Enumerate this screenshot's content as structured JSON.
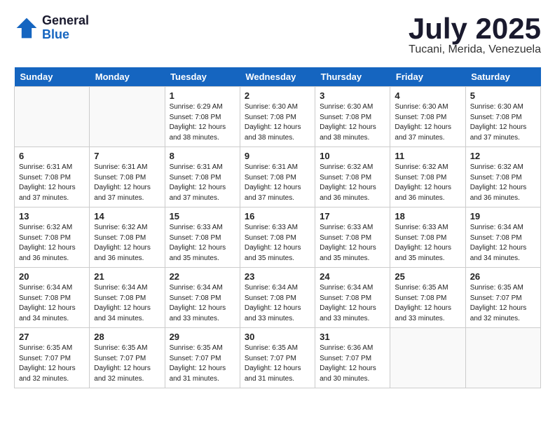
{
  "logo": {
    "general": "General",
    "blue": "Blue"
  },
  "header": {
    "month": "July 2025",
    "location": "Tucani, Merida, Venezuela"
  },
  "weekdays": [
    "Sunday",
    "Monday",
    "Tuesday",
    "Wednesday",
    "Thursday",
    "Friday",
    "Saturday"
  ],
  "weeks": [
    [
      {
        "day": "",
        "info": ""
      },
      {
        "day": "",
        "info": ""
      },
      {
        "day": "1",
        "info": "Sunrise: 6:29 AM\nSunset: 7:08 PM\nDaylight: 12 hours and 38 minutes."
      },
      {
        "day": "2",
        "info": "Sunrise: 6:30 AM\nSunset: 7:08 PM\nDaylight: 12 hours and 38 minutes."
      },
      {
        "day": "3",
        "info": "Sunrise: 6:30 AM\nSunset: 7:08 PM\nDaylight: 12 hours and 38 minutes."
      },
      {
        "day": "4",
        "info": "Sunrise: 6:30 AM\nSunset: 7:08 PM\nDaylight: 12 hours and 37 minutes."
      },
      {
        "day": "5",
        "info": "Sunrise: 6:30 AM\nSunset: 7:08 PM\nDaylight: 12 hours and 37 minutes."
      }
    ],
    [
      {
        "day": "6",
        "info": "Sunrise: 6:31 AM\nSunset: 7:08 PM\nDaylight: 12 hours and 37 minutes."
      },
      {
        "day": "7",
        "info": "Sunrise: 6:31 AM\nSunset: 7:08 PM\nDaylight: 12 hours and 37 minutes."
      },
      {
        "day": "8",
        "info": "Sunrise: 6:31 AM\nSunset: 7:08 PM\nDaylight: 12 hours and 37 minutes."
      },
      {
        "day": "9",
        "info": "Sunrise: 6:31 AM\nSunset: 7:08 PM\nDaylight: 12 hours and 37 minutes."
      },
      {
        "day": "10",
        "info": "Sunrise: 6:32 AM\nSunset: 7:08 PM\nDaylight: 12 hours and 36 minutes."
      },
      {
        "day": "11",
        "info": "Sunrise: 6:32 AM\nSunset: 7:08 PM\nDaylight: 12 hours and 36 minutes."
      },
      {
        "day": "12",
        "info": "Sunrise: 6:32 AM\nSunset: 7:08 PM\nDaylight: 12 hours and 36 minutes."
      }
    ],
    [
      {
        "day": "13",
        "info": "Sunrise: 6:32 AM\nSunset: 7:08 PM\nDaylight: 12 hours and 36 minutes."
      },
      {
        "day": "14",
        "info": "Sunrise: 6:32 AM\nSunset: 7:08 PM\nDaylight: 12 hours and 36 minutes."
      },
      {
        "day": "15",
        "info": "Sunrise: 6:33 AM\nSunset: 7:08 PM\nDaylight: 12 hours and 35 minutes."
      },
      {
        "day": "16",
        "info": "Sunrise: 6:33 AM\nSunset: 7:08 PM\nDaylight: 12 hours and 35 minutes."
      },
      {
        "day": "17",
        "info": "Sunrise: 6:33 AM\nSunset: 7:08 PM\nDaylight: 12 hours and 35 minutes."
      },
      {
        "day": "18",
        "info": "Sunrise: 6:33 AM\nSunset: 7:08 PM\nDaylight: 12 hours and 35 minutes."
      },
      {
        "day": "19",
        "info": "Sunrise: 6:34 AM\nSunset: 7:08 PM\nDaylight: 12 hours and 34 minutes."
      }
    ],
    [
      {
        "day": "20",
        "info": "Sunrise: 6:34 AM\nSunset: 7:08 PM\nDaylight: 12 hours and 34 minutes."
      },
      {
        "day": "21",
        "info": "Sunrise: 6:34 AM\nSunset: 7:08 PM\nDaylight: 12 hours and 34 minutes."
      },
      {
        "day": "22",
        "info": "Sunrise: 6:34 AM\nSunset: 7:08 PM\nDaylight: 12 hours and 33 minutes."
      },
      {
        "day": "23",
        "info": "Sunrise: 6:34 AM\nSunset: 7:08 PM\nDaylight: 12 hours and 33 minutes."
      },
      {
        "day": "24",
        "info": "Sunrise: 6:34 AM\nSunset: 7:08 PM\nDaylight: 12 hours and 33 minutes."
      },
      {
        "day": "25",
        "info": "Sunrise: 6:35 AM\nSunset: 7:08 PM\nDaylight: 12 hours and 33 minutes."
      },
      {
        "day": "26",
        "info": "Sunrise: 6:35 AM\nSunset: 7:07 PM\nDaylight: 12 hours and 32 minutes."
      }
    ],
    [
      {
        "day": "27",
        "info": "Sunrise: 6:35 AM\nSunset: 7:07 PM\nDaylight: 12 hours and 32 minutes."
      },
      {
        "day": "28",
        "info": "Sunrise: 6:35 AM\nSunset: 7:07 PM\nDaylight: 12 hours and 32 minutes."
      },
      {
        "day": "29",
        "info": "Sunrise: 6:35 AM\nSunset: 7:07 PM\nDaylight: 12 hours and 31 minutes."
      },
      {
        "day": "30",
        "info": "Sunrise: 6:35 AM\nSunset: 7:07 PM\nDaylight: 12 hours and 31 minutes."
      },
      {
        "day": "31",
        "info": "Sunrise: 6:36 AM\nSunset: 7:07 PM\nDaylight: 12 hours and 30 minutes."
      },
      {
        "day": "",
        "info": ""
      },
      {
        "day": "",
        "info": ""
      }
    ]
  ]
}
